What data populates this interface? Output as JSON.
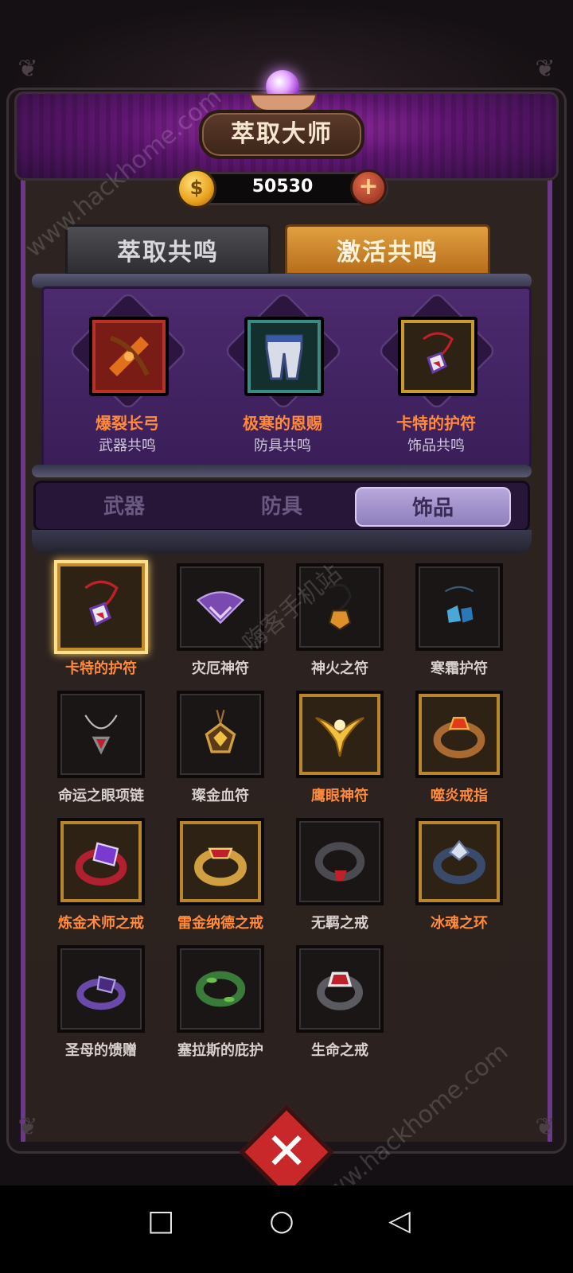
{
  "header": {
    "title": "萃取大师",
    "coins": "50530",
    "coin_icon": "gold-coin-icon",
    "add_icon": "plus-icon"
  },
  "main_tabs": [
    {
      "label": "萃取共鸣",
      "active": false
    },
    {
      "label": "激活共鸣",
      "active": true
    }
  ],
  "resonance": [
    {
      "name": "爆裂长弓",
      "type": "武器共鸣",
      "icon": "crossbow-icon",
      "frame_color": "#b8322a"
    },
    {
      "name": "极寒的恩赐",
      "type": "防具共鸣",
      "icon": "pants-icon",
      "frame_color": "#3a8a86"
    },
    {
      "name": "卡特的护符",
      "type": "饰品共鸣",
      "icon": "amulet-icon",
      "frame_color": "#c89a30"
    }
  ],
  "sub_tabs": [
    {
      "label": "武器",
      "active": false
    },
    {
      "label": "防具",
      "active": false
    },
    {
      "label": "饰品",
      "active": true
    }
  ],
  "items": [
    {
      "name": "卡特的护符",
      "icon": "amulet-icon",
      "tier": "gold",
      "selected": true
    },
    {
      "name": "灾厄神符",
      "icon": "wing-charm-icon",
      "tier": "normal"
    },
    {
      "name": "神火之符",
      "icon": "fire-pendant-icon",
      "tier": "normal"
    },
    {
      "name": "寒霜护符",
      "icon": "frost-charm-icon",
      "tier": "normal"
    },
    {
      "name": "命运之眼项链",
      "icon": "necklace-icon",
      "tier": "normal"
    },
    {
      "name": "璨金血符",
      "icon": "gold-pendant-icon",
      "tier": "normal"
    },
    {
      "name": "鹰眼神符",
      "icon": "eagle-charm-icon",
      "tier": "gold"
    },
    {
      "name": "噬炎戒指",
      "icon": "flame-ring-icon",
      "tier": "gold"
    },
    {
      "name": "炼金术师之戒",
      "icon": "purple-ring-icon",
      "tier": "gold"
    },
    {
      "name": "雷金纳德之戒",
      "icon": "gold-ring-icon",
      "tier": "gold"
    },
    {
      "name": "无羁之戒",
      "icon": "dark-ring-icon",
      "tier": "normal"
    },
    {
      "name": "冰魂之环",
      "icon": "ice-ring-icon",
      "tier": "gold"
    },
    {
      "name": "圣母的馈赠",
      "icon": "violet-ring-icon",
      "tier": "normal"
    },
    {
      "name": "塞拉斯的庇护",
      "icon": "leaf-ring-icon",
      "tier": "normal"
    },
    {
      "name": "生命之戒",
      "icon": "life-ring-icon",
      "tier": "normal"
    }
  ],
  "bottom": {
    "emblem_icon": "crossed-swords-icon"
  },
  "nav": {
    "square": "□",
    "circle": "○",
    "back": "◁"
  },
  "watermarks": {
    "site": "www.hackhome.com",
    "cn": "嗨客手机站"
  }
}
